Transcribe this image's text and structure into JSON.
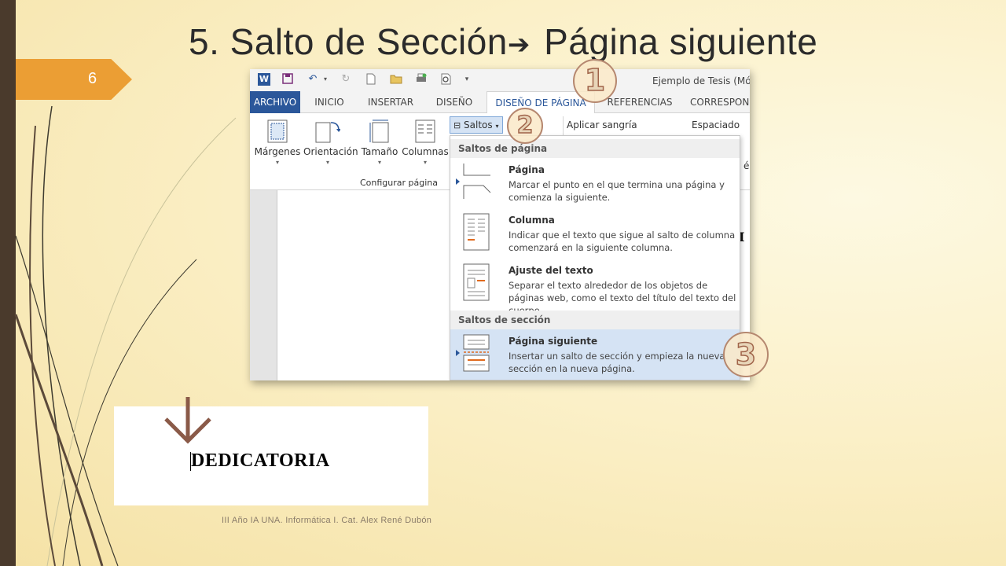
{
  "slide": {
    "title_part1": "5. Salto de Sección",
    "title_arrow": "➔",
    "title_part2": " Página siguiente",
    "number": "6",
    "footer": "III Año IA UNA. Informática I. Cat. Alex René Dubón"
  },
  "word": {
    "doc_title": "Ejemplo de Tesis (Mó",
    "tabs": [
      "ARCHIVO",
      "INICIO",
      "INSERTAR",
      "DISEÑO",
      "DISEÑO DE PÁGINA",
      "REFERENCIAS",
      "CORRESPON"
    ],
    "ribbon": {
      "buttons": [
        "Márgenes",
        "Orientación",
        "Tamaño",
        "Columnas"
      ],
      "group_label": "Configurar página",
      "saltos_label": "Saltos",
      "aplicar_sangria": "Aplicar sangría",
      "espaciado": "Espaciado",
      "ribbon_fragment": "és",
      "page_fragment": "I"
    },
    "dropdown": {
      "section1_header": "Saltos de página",
      "section2_header": "Saltos de sección",
      "items": [
        {
          "title": "Página",
          "desc": "Marcar el punto en el que termina una página y comienza la siguiente."
        },
        {
          "title": "Columna",
          "desc": "Indicar que el texto que sigue al salto de columna comenzará en la siguiente columna."
        },
        {
          "title": "Ajuste del texto",
          "desc": "Separar el texto alrededor de los objetos de páginas web, como el texto del título del texto del cuerpo."
        },
        {
          "title": "Página siguiente",
          "desc": "Insertar un salto de sección y empieza la nueva sección en la nueva página."
        }
      ]
    }
  },
  "callouts": [
    "1",
    "2",
    "3"
  ],
  "dedicatoria": {
    "text": "DEDICATORIA"
  },
  "colors": {
    "left_bar": "#4a3a2c",
    "badge": "#eb9e34",
    "word_blue": "#2b579a",
    "arrow": "#8a5a48"
  }
}
